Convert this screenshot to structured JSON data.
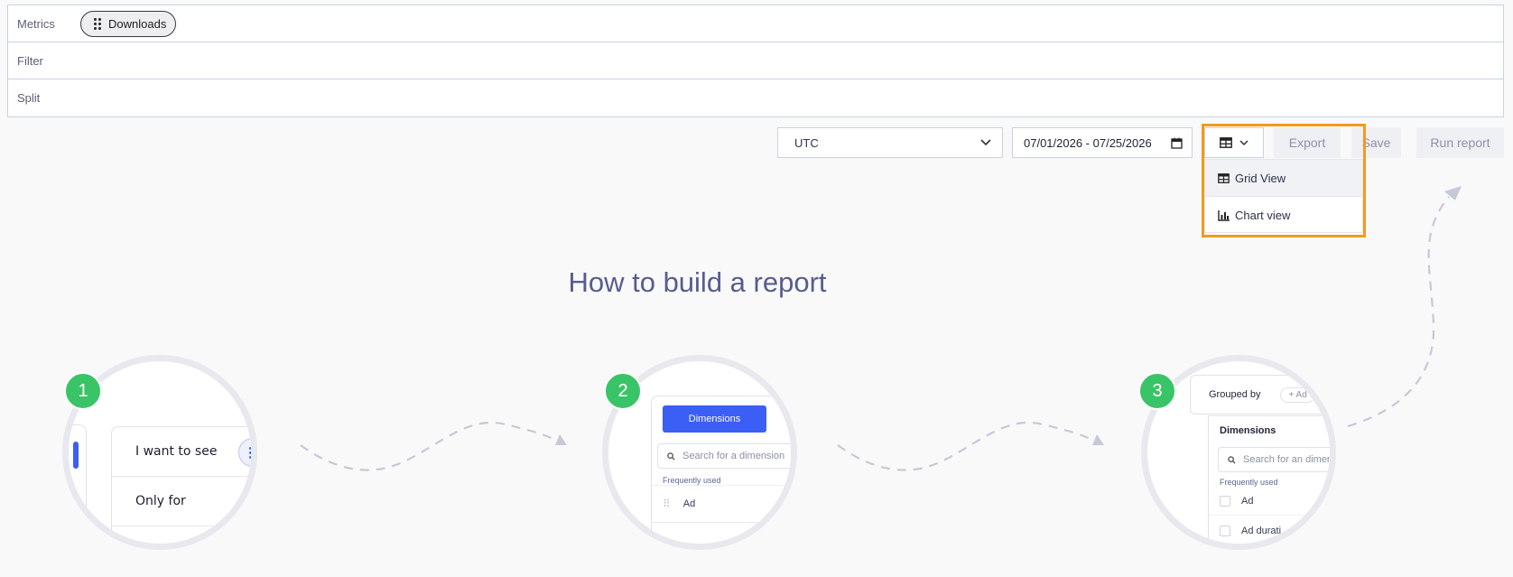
{
  "query": {
    "metrics_label": "Metrics",
    "metric_chip": "Downloads",
    "filter_label": "Filter",
    "split_label": "Split"
  },
  "toolbar": {
    "timezone": "UTC",
    "date_range": "07/01/2026 - 07/25/2026",
    "export_label": "Export",
    "save_label": "Save",
    "run_label": "Run report"
  },
  "view_menu": {
    "items": [
      {
        "label": "Grid View",
        "icon": "table-icon"
      },
      {
        "label": "Chart view",
        "icon": "bar-chart-icon"
      }
    ]
  },
  "guide": {
    "title": "How to build a report",
    "steps": [
      {
        "number": "1",
        "rows": [
          "I want to see",
          "Only for"
        ]
      },
      {
        "number": "2",
        "tab": "Dimensions",
        "search": "Search for a dimension",
        "section": "Frequently used",
        "item": "Ad"
      },
      {
        "number": "3",
        "grouped": "Grouped by",
        "add": "+ Ad",
        "title": "Dimensions",
        "search": "Search for an dimen",
        "section": "Frequently used",
        "item1": "Ad",
        "item2": "Ad durati"
      }
    ]
  },
  "colors": {
    "accent": "#3b5ef5",
    "badge": "#3ac468",
    "highlight": "#f39a1e"
  }
}
